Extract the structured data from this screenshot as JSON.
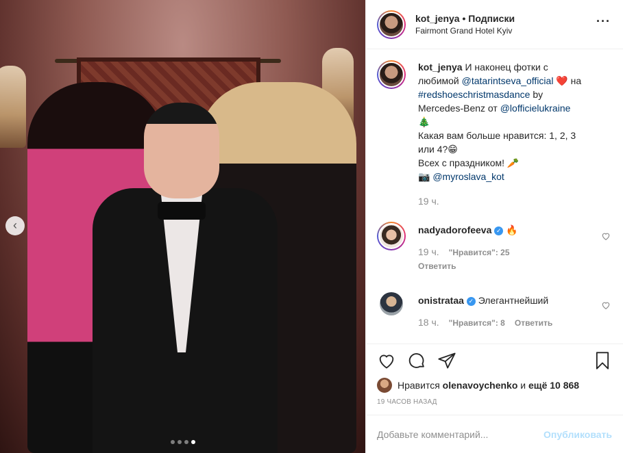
{
  "post": {
    "username": "kot_jenya",
    "separator": "•",
    "follow_label": "Подписки",
    "location": "Fairmont Grand Hotel Kyiv",
    "more_icon": "more-horizontal-icon",
    "carousel": {
      "total": 4,
      "active_index": 3
    }
  },
  "caption": {
    "username": "kot_jenya",
    "text1": "И наконец фотки с любимой",
    "mention1": "@tatarintseva_official",
    "emoji1": "❤️",
    "text2": "на",
    "hashtag": "#redshoeschristmasdance",
    "text3": "by Mercedes-Benz от",
    "mention2": "@lofficielukraine",
    "emoji2": "🎄",
    "line2": "Какая вам больше нравится: 1, 2, 3 или 4?😁",
    "line3": "Всех с праздником! 🥕",
    "camera": "📷",
    "mention3": "@myroslava_kot",
    "time": "19 ч."
  },
  "comments": [
    {
      "username": "nadyadorofeeva",
      "verified": "✓",
      "text": "🔥",
      "time": "19 ч.",
      "likes_label": "\"Нравится\": 25",
      "reply_label": "Ответить"
    },
    {
      "username": "onistrataa",
      "verified": "✓",
      "text": "Элегантнейший",
      "time": "18 ч.",
      "likes_label": "\"Нравится\": 8",
      "reply_label": "Ответить"
    }
  ],
  "likes": {
    "prefix": "Нравится",
    "user": "olenavoychenko",
    "middle": "и",
    "others": "ещё 10 868"
  },
  "timestamp": "19 ЧАСОВ НАЗАД",
  "add_comment": {
    "placeholder": "Добавьте комментарий...",
    "publish_label": "Опубликовать"
  },
  "colors": {
    "link": "#00376b",
    "muted": "#8e8e8e",
    "verified": "#3897f0",
    "publish": "#b2dffc"
  }
}
